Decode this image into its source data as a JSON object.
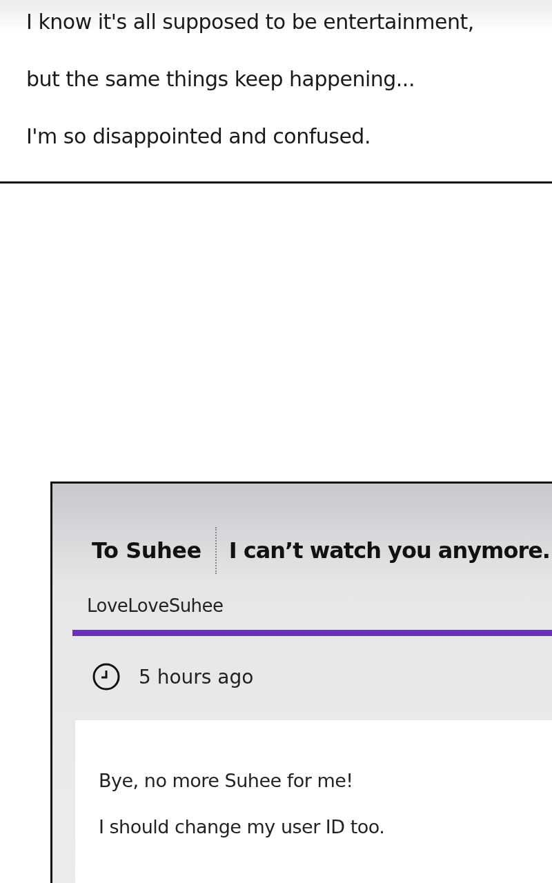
{
  "caption": {
    "lines": [
      "I know it's all supposed to be entertainment,",
      "but the same things keep happening...",
      "I'm so disappointed and confused."
    ]
  },
  "post": {
    "board": "To Suhee",
    "title": "I can’t watch you anymore.",
    "author": "LoveLoveSuhee",
    "time": "5 hours ago",
    "body": [
      "Bye, no more Suhee for me!",
      "I should change my user ID too."
    ]
  }
}
